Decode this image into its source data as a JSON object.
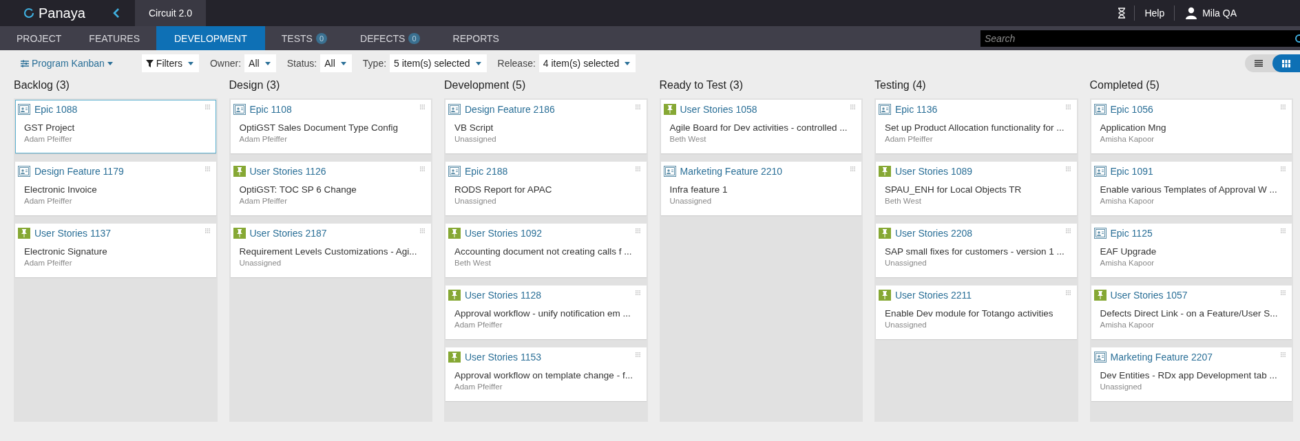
{
  "app": {
    "logo": "Panaya",
    "project_tab": "Circuit 2.0"
  },
  "header_right": {
    "help": "Help",
    "user": "Mila QA"
  },
  "nav_tabs": [
    {
      "label": "PROJECT",
      "selected": false
    },
    {
      "label": "FEATURES",
      "selected": false
    },
    {
      "label": "DEVELOPMENT",
      "selected": true
    },
    {
      "label": "TESTS",
      "badge": "0",
      "selected": false
    },
    {
      "label": "DEFECTS",
      "badge": "0",
      "selected": false
    },
    {
      "label": "REPORTS",
      "selected": false
    }
  ],
  "search": {
    "placeholder": "Search"
  },
  "toolbar": {
    "view_menu": "Program Kanban",
    "filters": "Filters",
    "dropdowns": [
      {
        "label": "Owner:",
        "value": "All"
      },
      {
        "label": "Status:",
        "value": "All"
      },
      {
        "label": "Type:",
        "value": "5 item(s) selected"
      },
      {
        "label": "Release:",
        "value": "4 item(s) selected"
      }
    ]
  },
  "view_toggle": [
    {
      "kind": "list",
      "selected": false
    },
    {
      "kind": "board",
      "selected": true
    }
  ],
  "columns": [
    {
      "title": "Backlog (3)",
      "cards": [
        {
          "kind": "epic",
          "id": "Epic 1088",
          "title": "GST Project",
          "owner": "Adam Pfeiffer",
          "selected": true
        },
        {
          "kind": "epic",
          "id": "Design Feature 1179",
          "title": "Electronic Invoice",
          "owner": "Adam Pfeiffer",
          "selected": false
        },
        {
          "kind": "story",
          "id": "User Stories 1137",
          "title": "Electronic Signature",
          "owner": "Adam Pfeiffer",
          "selected": false
        }
      ]
    },
    {
      "title": "Design (3)",
      "cards": [
        {
          "kind": "epic",
          "id": "Epic 1108",
          "title": "OptiGST Sales Document Type Config",
          "owner": "Adam Pfeiffer",
          "selected": false
        },
        {
          "kind": "story",
          "id": "User Stories 1126",
          "title": "OptiGST: TOC SP 6 Change",
          "owner": "Adam Pfeiffer",
          "selected": false
        },
        {
          "kind": "story",
          "id": "User Stories 2187",
          "title": "Requirement Levels Customizations - Agi...",
          "owner": "Unassigned",
          "selected": false
        }
      ]
    },
    {
      "title": "Development (5)",
      "cards": [
        {
          "kind": "epic",
          "id": "Design Feature 2186",
          "title": "VB Script",
          "owner": "Unassigned",
          "selected": false
        },
        {
          "kind": "epic",
          "id": "Epic 2188",
          "title": "RODS Report for APAC",
          "owner": "Unassigned",
          "selected": false
        },
        {
          "kind": "story",
          "id": "User Stories 1092",
          "title": "Accounting document not creating calls f ...",
          "owner": "Beth West",
          "selected": false
        },
        {
          "kind": "story",
          "id": "User Stories 1128",
          "title": "Approval workflow - unify notification em ...",
          "owner": "Adam Pfeiffer",
          "selected": false
        },
        {
          "kind": "story",
          "id": "User Stories 1153",
          "title": "Approval workflow on template change - f...",
          "owner": "Adam Pfeiffer",
          "selected": false
        }
      ]
    },
    {
      "title": "Ready to Test (3)",
      "cards": [
        {
          "kind": "story",
          "id": "User Stories 1058",
          "title": "Agile Board for Dev activities - controlled ...",
          "owner": "Beth West",
          "selected": false
        },
        {
          "kind": "epic",
          "id": "Marketing Feature 2210",
          "title": "Infra feature 1",
          "owner": "Unassigned",
          "selected": false
        }
      ]
    },
    {
      "title": "Testing (4)",
      "cards": [
        {
          "kind": "epic",
          "id": "Epic 1136",
          "title": "Set up Product Allocation functionality for ...",
          "owner": "Adam Pfeiffer",
          "selected": false
        },
        {
          "kind": "story",
          "id": "User Stories 1089",
          "title": "SPAU_ENH for Local Objects TR",
          "owner": "Beth West",
          "selected": false
        },
        {
          "kind": "story",
          "id": "User Stories 2208",
          "title": "SAP small fixes for customers - version 1 ...",
          "owner": "Unassigned",
          "selected": false
        },
        {
          "kind": "story",
          "id": "User Stories 2211",
          "title": "Enable Dev module for Totango activities",
          "owner": "Unassigned",
          "selected": false
        }
      ]
    },
    {
      "title": "Completed (5)",
      "cards": [
        {
          "kind": "epic",
          "id": "Epic 1056",
          "title": "Application Mng",
          "owner": "Amisha Kapoor",
          "selected": false
        },
        {
          "kind": "epic",
          "id": "Epic 1091",
          "title": "Enable various Templates of Approval W ...",
          "owner": "Amisha Kapoor",
          "selected": false
        },
        {
          "kind": "epic",
          "id": "Epic 1125",
          "title": "EAF Upgrade",
          "owner": "Amisha Kapoor",
          "selected": false
        },
        {
          "kind": "story",
          "id": "User Stories 1057",
          "title": "Defects Direct Link - on a Feature/User S...",
          "owner": "Amisha Kapoor",
          "selected": false
        },
        {
          "kind": "epic",
          "id": "Marketing Feature 2207",
          "title": "Dev Entities - RDx app Development tab ...",
          "owner": "Unassigned",
          "selected": false
        }
      ]
    }
  ]
}
